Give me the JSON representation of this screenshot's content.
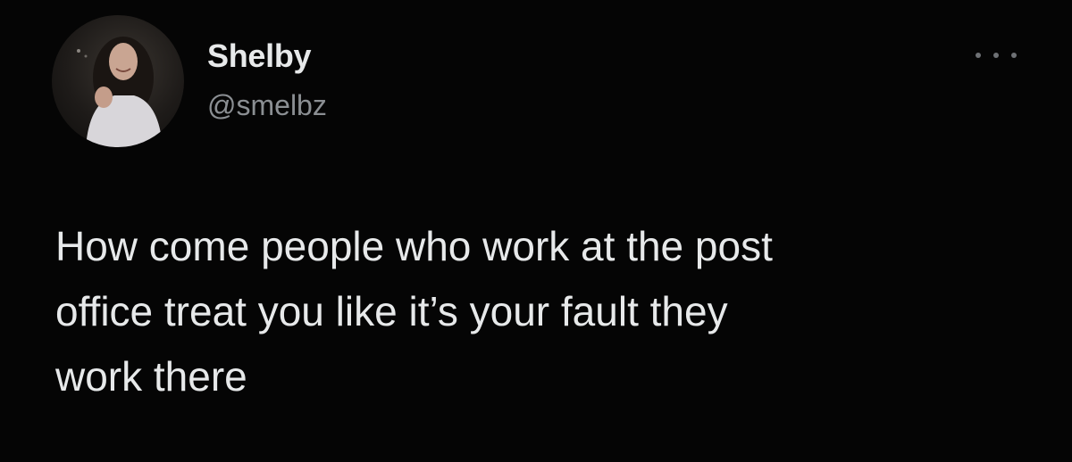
{
  "author": {
    "name": "Shelby",
    "handle": "@smelbz"
  },
  "icons": {
    "avatar": "profile-photo",
    "more": "more-options-icon"
  },
  "tweet": {
    "lines": [
      "How come people who work at the post",
      "office treat you like it’s your fault they",
      "work there"
    ]
  },
  "colors": {
    "background": "#050505",
    "text": "#e7e9ea",
    "handle": "#8b8f93"
  }
}
